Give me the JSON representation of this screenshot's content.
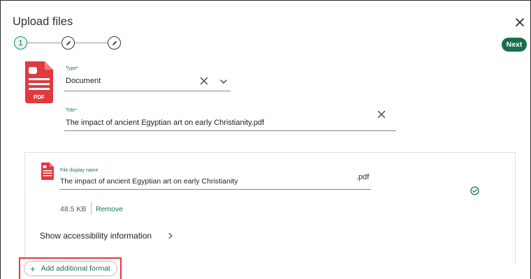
{
  "dialog": {
    "title": "Upload files",
    "next_label": "Next",
    "close_icon": "close-icon"
  },
  "stepper": {
    "steps": [
      {
        "label": "1",
        "state": "active"
      },
      {
        "icon": "pencil-icon",
        "state": "pending"
      },
      {
        "icon": "pencil-icon",
        "state": "pending"
      }
    ]
  },
  "form": {
    "file_icon": "pdf-file-icon",
    "file_icon_text": "PDF",
    "type": {
      "label": "Type*",
      "value": "Document"
    },
    "title": {
      "label": "Title*",
      "value": "The impact of ancient Egyptian art on early Christianity.pdf"
    }
  },
  "file_card": {
    "display_name_label": "File display name",
    "display_name_value": "The impact of ancient Egyptian art on early Christianity",
    "extension": ".pdf",
    "size": "48.5 KB",
    "remove_label": "Remove",
    "status_icon": "check-circle-icon",
    "accessibility_label": "Show accessibility information"
  },
  "add_format": {
    "label": "Add additional format",
    "icon": "plus-icon"
  },
  "colors": {
    "accent": "#1a6e4b",
    "pdf_red": "#e0393e",
    "highlight": "#e0393e"
  }
}
